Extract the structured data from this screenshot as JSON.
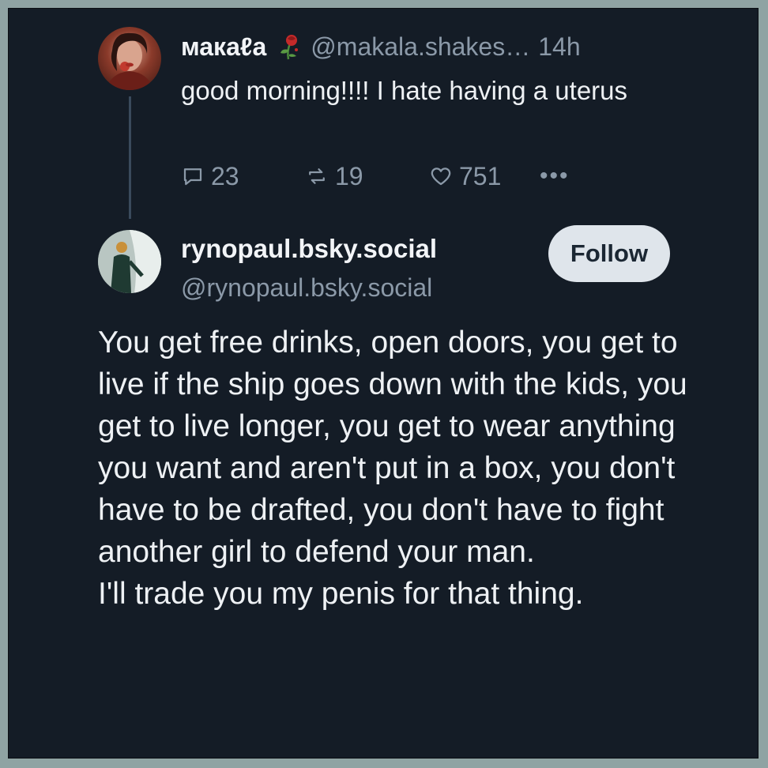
{
  "original_post": {
    "display_name": "макаℓa",
    "handle": "@makala.shakes…",
    "time": "14h",
    "text": "good morning!!!! I hate having a uterus",
    "replies": "23",
    "reposts": "19",
    "likes": "751",
    "more_label": "•••",
    "avatar_icon": "woman-portrait-avatar",
    "name_icon": "wilted-rose-icon"
  },
  "reply_post": {
    "display_name": "rynopaul.bsky.social",
    "handle": "@rynopaul.bsky.social",
    "follow_label": "Follow",
    "avatar_icon": "illustrated-figure-avatar",
    "text": "You get free drinks, open doors, you get to live if the ship goes down with the kids, you get to live longer, you get to wear anything you want and aren't put in a box, you don't have to be drafted, you don't have to fight another girl to defend your man.\nI'll trade you my penis for that thing."
  },
  "colors": {
    "background": "#141c26",
    "border": "#8fa3a3",
    "text_primary": "#eef1f4",
    "text_secondary": "#8b99a8",
    "follow_button": "#dfe5eb"
  }
}
